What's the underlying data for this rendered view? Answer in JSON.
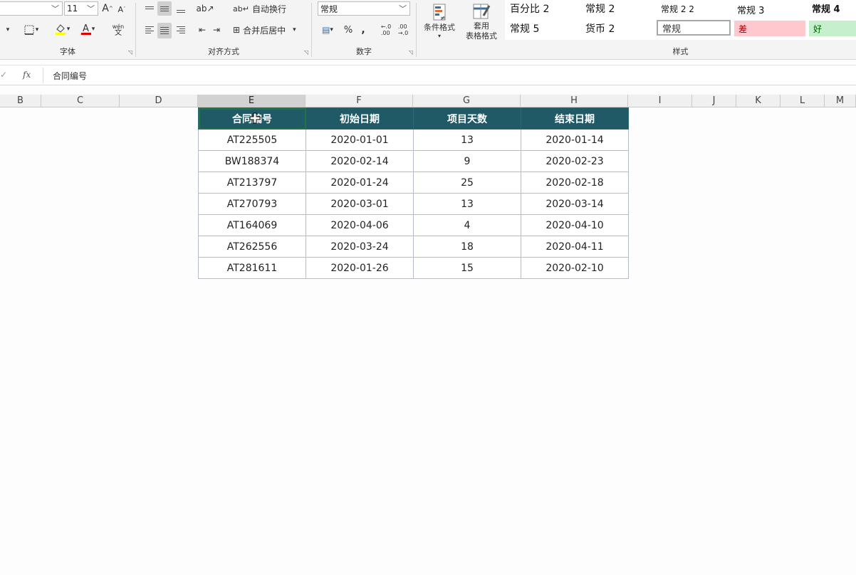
{
  "ribbon": {
    "font_group": {
      "label": "字体",
      "size": "11",
      "grow": "A",
      "shrink": "A",
      "phonetic": "wén",
      "phonetic_char": "文"
    },
    "align_group": {
      "label": "对齐方式",
      "wrap_text": "自动换行",
      "merge_center": "合并后居中"
    },
    "number_group": {
      "label": "数字",
      "format": "常规",
      "percent": "%",
      "comma": ","
    },
    "styles_group": {
      "label": "样式",
      "conditional_format": "条件格式",
      "table_format_line1": "套用",
      "table_format_line2": "表格格式",
      "cells": {
        "percent2": "百分比 2",
        "normal2": "常规 2",
        "normal22": "常规 2 2",
        "normal3": "常规 3",
        "normal4": "常规 4",
        "normal5": "常规 5",
        "currency2": "货币 2",
        "normal": "常规",
        "bad": "差",
        "good": "好"
      }
    }
  },
  "formula_bar": {
    "fx": "fx",
    "value": "合同编号"
  },
  "columns": [
    "B",
    "C",
    "D",
    "E",
    "F",
    "G",
    "H",
    "I",
    "J",
    "K",
    "L",
    "M"
  ],
  "table": {
    "headers": [
      "合同编号",
      "初始日期",
      "项目天数",
      "结束日期"
    ],
    "rows": [
      [
        "AT225505",
        "2020-01-01",
        "13",
        "2020-01-14"
      ],
      [
        "BW188374",
        "2020-02-14",
        "9",
        "2020-02-23"
      ],
      [
        "AT213797",
        "2020-01-24",
        "25",
        "2020-02-18"
      ],
      [
        "AT270793",
        "2020-03-01",
        "13",
        "2020-03-14"
      ],
      [
        "AT164069",
        "2020-04-06",
        "4",
        "2020-04-10"
      ],
      [
        "AT262556",
        "2020-03-24",
        "18",
        "2020-04-11"
      ],
      [
        "AT281611",
        "2020-01-26",
        "15",
        "2020-02-10"
      ]
    ]
  },
  "colors": {
    "header_bg": "#1f5a66",
    "bad_bg": "#ffc7ce",
    "bad_fg": "#9c0006",
    "good_bg": "#c6efce",
    "good_fg": "#006100",
    "selection": "#217346"
  }
}
